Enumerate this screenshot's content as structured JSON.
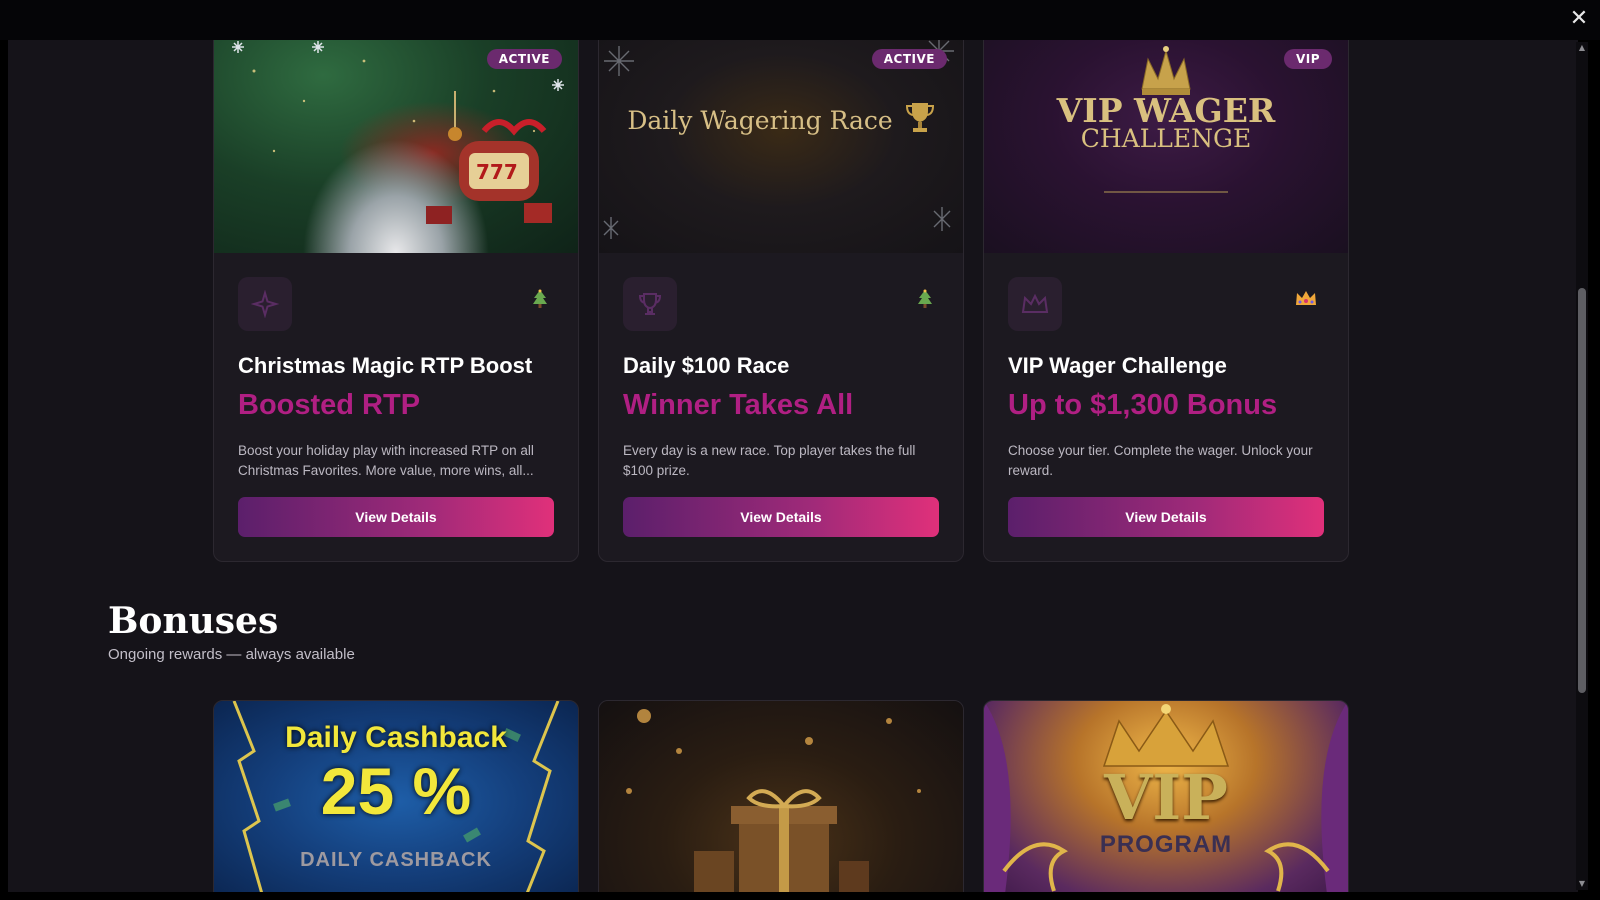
{
  "window": {
    "close_label": "✕"
  },
  "promotions": [
    {
      "badge": "ACTIVE",
      "icon": "sparkle-icon",
      "corner_icon": "christmas-tree-icon",
      "title": "Christmas Magic RTP Boost",
      "subtitle": "Boosted RTP",
      "description": "Boost your holiday play with increased RTP on all Christmas Favorites. More value, more wins, all...",
      "button_label": "View Details"
    },
    {
      "badge": "ACTIVE",
      "banner_text": "Daily Wagering Race",
      "icon": "trophy-icon",
      "corner_icon": "christmas-tree-icon",
      "title": "Daily $100 Race",
      "subtitle": "Winner Takes All",
      "description": "Every day is a new race. Top player takes the full $100 prize.",
      "button_label": "View Details"
    },
    {
      "badge": "VIP",
      "banner_line1": "VIP WAGER",
      "banner_line2": "CHALLENGE",
      "icon": "crown-icon",
      "corner_icon": "crown-emoji-icon",
      "title": "VIP Wager Challenge",
      "subtitle": "Up to $1,300 Bonus",
      "description": "Choose your tier. Complete the wager. Unlock your reward.",
      "button_label": "View Details"
    }
  ],
  "bonuses": {
    "title": "Bonuses",
    "subtitle": "Ongoing rewards — always available",
    "cards": [
      {
        "banner_title": "Daily Cashback",
        "banner_value": "25 %",
        "banner_footer": "DAILY CASHBACK"
      },
      {
        "banner_icon": "gift-icon"
      },
      {
        "banner_title": "VIP",
        "banner_footer": "PROGRAM"
      }
    ]
  },
  "colors": {
    "accent": "#b01f83",
    "button_gradient_start": "#5b1f6b",
    "button_gradient_end": "#e0307a",
    "page_bg": "#151319",
    "card_bg": "#1c1920"
  }
}
